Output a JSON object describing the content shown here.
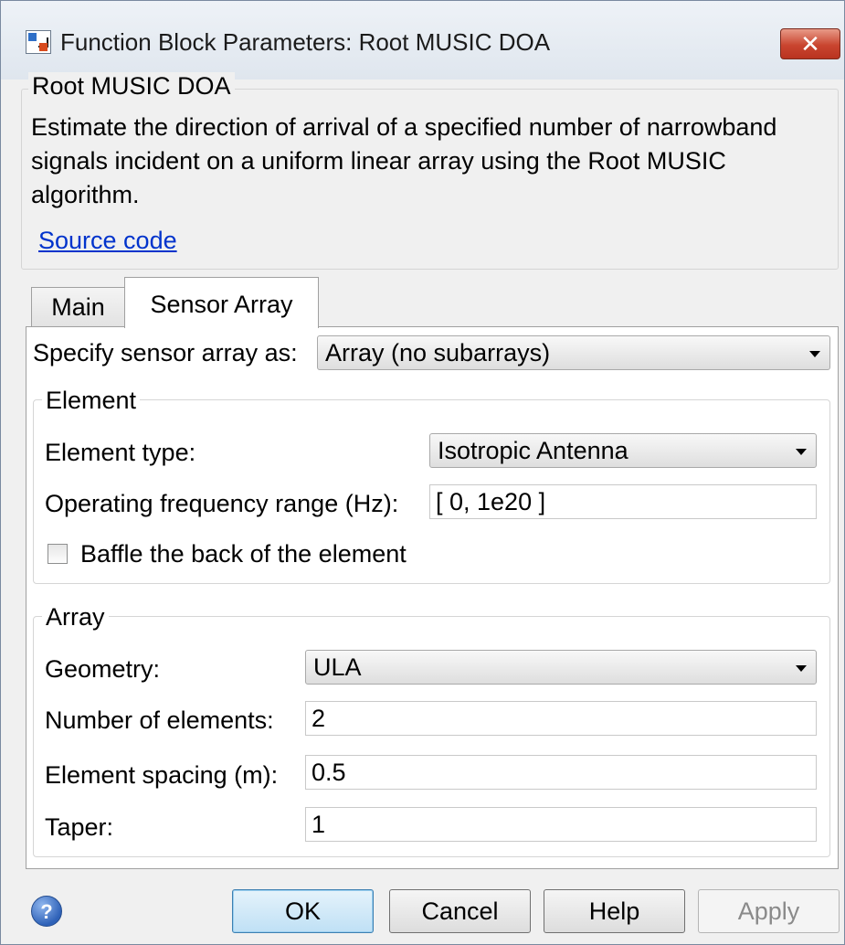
{
  "window": {
    "title": "Function Block Parameters: Root MUSIC DOA",
    "close_glyph": "✕"
  },
  "description": {
    "group_title": "Root MUSIC DOA",
    "text": "Estimate the direction of arrival of a specified number of narrowband signals incident on a uniform linear array using the Root MUSIC algorithm.",
    "source_link": "Source code"
  },
  "tabs": [
    {
      "label": "Main",
      "active": false
    },
    {
      "label": "Sensor Array",
      "active": true
    }
  ],
  "sensor_array": {
    "specify_label": "Specify sensor array as:",
    "specify_value": "Array (no subarrays)",
    "element": {
      "title": "Element",
      "type_label": "Element type:",
      "type_value": "Isotropic Antenna",
      "freq_label": "Operating frequency range (Hz):",
      "freq_value": "[ 0, 1e20 ]",
      "baffle_label": "Baffle the back of the element",
      "baffle_checked": false
    },
    "array": {
      "title": "Array",
      "geometry_label": "Geometry:",
      "geometry_value": "ULA",
      "num_label": "Number of elements:",
      "num_value": "2",
      "spacing_label": "Element spacing (m):",
      "spacing_value": "0.5",
      "taper_label": "Taper:",
      "taper_value": "1"
    }
  },
  "buttons": {
    "help_icon_glyph": "?",
    "ok": "OK",
    "cancel": "Cancel",
    "help": "Help",
    "apply": "Apply"
  }
}
